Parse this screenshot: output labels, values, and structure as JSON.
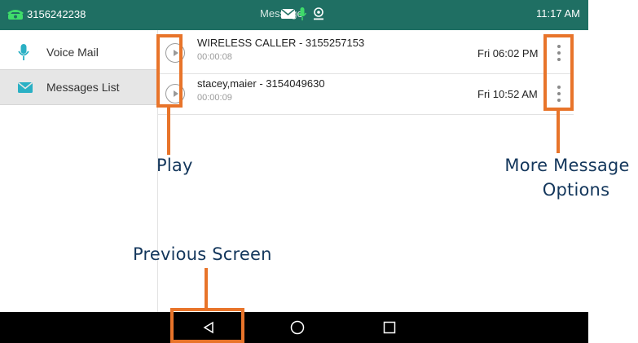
{
  "status_bar": {
    "phone_number": "3156242238",
    "title": "Message",
    "time": "11:17 AM",
    "icons": [
      "phone-icon",
      "envelope-icon",
      "mic-icon",
      "location-icon"
    ]
  },
  "sidebar": {
    "items": [
      {
        "label": "Voice Mail",
        "icon": "microphone-icon",
        "active": false
      },
      {
        "label": "Messages List",
        "icon": "envelope-icon",
        "active": true
      }
    ]
  },
  "messages": [
    {
      "caller": "WIRELESS CALLER - 3155257153",
      "duration": "00:00:08",
      "time": "Fri 06:02 PM"
    },
    {
      "caller": "stacey,maier - 3154049630",
      "duration": "00:00:09",
      "time": "Fri 10:52 AM"
    }
  ],
  "nav": {
    "buttons": [
      "back-icon",
      "home-icon",
      "recent-apps-icon"
    ]
  },
  "annotations": {
    "play": "Play",
    "more_line1": "More Message",
    "more_line2": "Options",
    "previous": "Previous Screen"
  },
  "colors": {
    "status_bar": "#1f6f63",
    "accent": "#2ab0c4",
    "annotation": "#e8742a",
    "annotation_text": "#14375c"
  }
}
